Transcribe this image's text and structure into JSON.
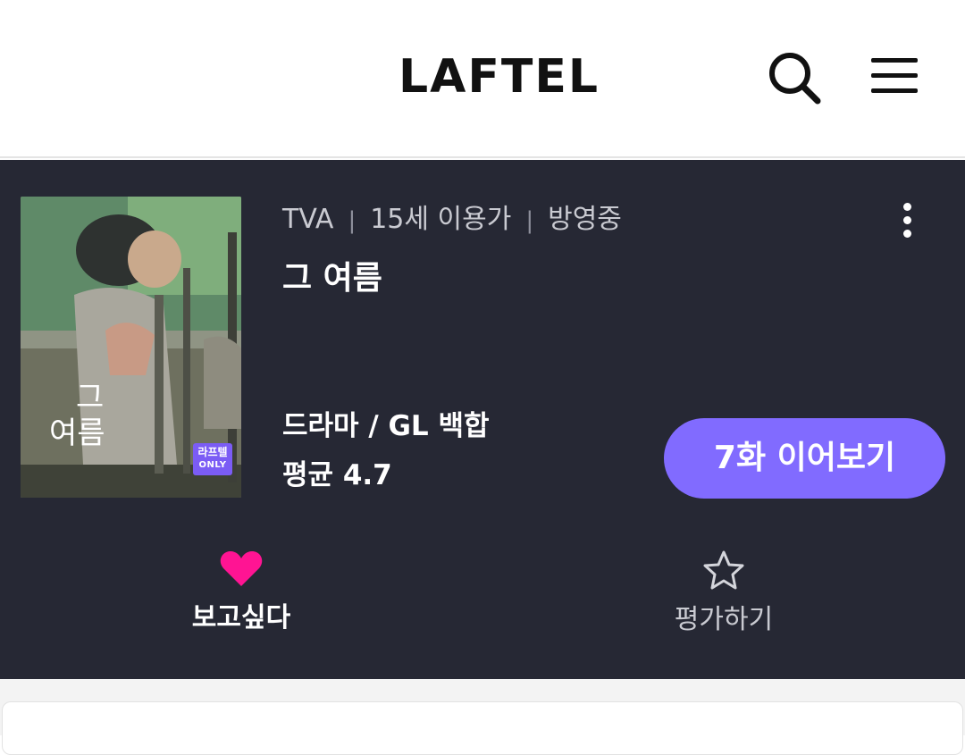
{
  "header": {
    "logo": "LAFTEL",
    "search_icon": "search-icon",
    "menu_icon": "hamburger-menu-icon"
  },
  "detail": {
    "poster": {
      "title_line1": "그",
      "title_line2": "여름",
      "badge_line1": "라프텔",
      "badge_line2": "ONLY"
    },
    "meta": {
      "format": "TVA",
      "age_rating": "15세 이용가",
      "status": "방영중"
    },
    "title": "그 여름",
    "more_icon": "more-vertical-icon",
    "genre": "드라마 / GL 백합",
    "rating": "평균 4.7",
    "continue_button": "7화 이어보기",
    "actions": {
      "wishlist_label": "보고싶다",
      "wishlist_icon": "heart-icon",
      "rate_label": "평가하기",
      "rate_icon": "star-outline-icon"
    }
  },
  "colors": {
    "panel_bg": "#262834",
    "accent": "#816bff",
    "heart": "#ff1493"
  }
}
